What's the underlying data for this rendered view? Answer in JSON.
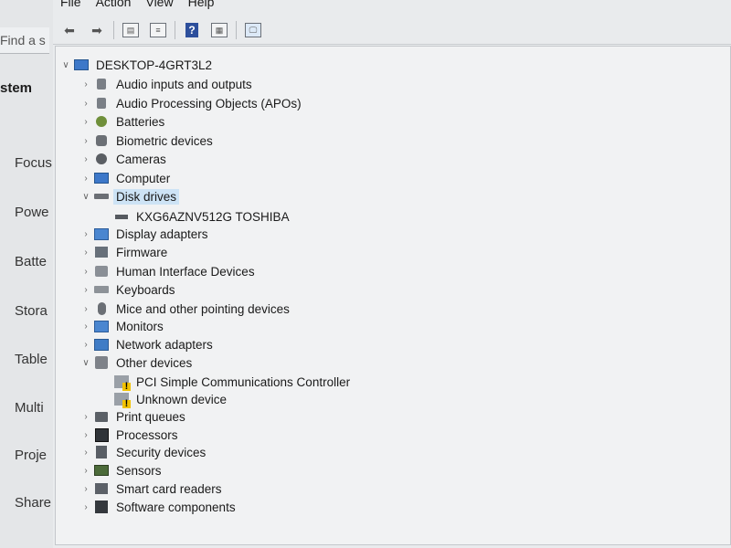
{
  "background": {
    "search_placeholder": "Find a s",
    "section_heading": "stem",
    "items": [
      {
        "label": "Focus",
        "icon": "focus-icon"
      },
      {
        "label": "Powe",
        "icon": "power-icon"
      },
      {
        "label": "Batte",
        "icon": "battery-icon"
      },
      {
        "label": "Stora",
        "icon": "storage-icon"
      },
      {
        "label": "Table",
        "icon": "tablet-icon"
      },
      {
        "label": "Multi",
        "icon": "multitasking-icon"
      },
      {
        "label": "Proje",
        "icon": "projecting-icon"
      },
      {
        "label": "Share",
        "icon": "share-icon"
      }
    ]
  },
  "menubar": {
    "items": [
      "File",
      "Action",
      "View",
      "Help"
    ]
  },
  "toolbar": {
    "buttons": [
      "back-arrow-icon",
      "forward-arrow-icon",
      "show-hide-tree-icon",
      "properties-icon",
      "help-icon",
      "view-options-icon",
      "scan-hardware-icon"
    ]
  },
  "tree": {
    "root": "DESKTOP-4GRT3L2",
    "nodes": [
      {
        "label": "Audio inputs and outputs",
        "icon": "speaker-icon",
        "expanded": false
      },
      {
        "label": "Audio Processing Objects (APOs)",
        "icon": "speaker-icon",
        "expanded": false
      },
      {
        "label": "Batteries",
        "icon": "battery-icon",
        "expanded": false
      },
      {
        "label": "Biometric devices",
        "icon": "biometric-icon",
        "expanded": false
      },
      {
        "label": "Cameras",
        "icon": "camera-icon",
        "expanded": false
      },
      {
        "label": "Computer",
        "icon": "computer-icon",
        "expanded": false
      },
      {
        "label": "Disk drives",
        "icon": "disk-drive-icon",
        "expanded": true,
        "selected": true,
        "children": [
          {
            "label": "KXG6AZNV512G TOSHIBA",
            "icon": "disk-drive-icon"
          }
        ]
      },
      {
        "label": "Display adapters",
        "icon": "monitor-icon",
        "expanded": false
      },
      {
        "label": "Firmware",
        "icon": "chip-icon",
        "expanded": false
      },
      {
        "label": "Human Interface Devices",
        "icon": "hid-icon",
        "expanded": false
      },
      {
        "label": "Keyboards",
        "icon": "keyboard-icon",
        "expanded": false
      },
      {
        "label": "Mice and other pointing devices",
        "icon": "mouse-icon",
        "expanded": false
      },
      {
        "label": "Monitors",
        "icon": "monitor-icon",
        "expanded": false
      },
      {
        "label": "Network adapters",
        "icon": "network-icon",
        "expanded": false
      },
      {
        "label": "Other devices",
        "icon": "other-devices-icon",
        "expanded": true,
        "children": [
          {
            "label": "PCI Simple Communications Controller",
            "icon": "warning-device-icon"
          },
          {
            "label": "Unknown device",
            "icon": "warning-device-icon"
          }
        ]
      },
      {
        "label": "Print queues",
        "icon": "printer-icon",
        "expanded": false
      },
      {
        "label": "Processors",
        "icon": "processor-icon",
        "expanded": false
      },
      {
        "label": "Security devices",
        "icon": "security-icon",
        "expanded": false
      },
      {
        "label": "Sensors",
        "icon": "sensor-icon",
        "expanded": false
      },
      {
        "label": "Smart card readers",
        "icon": "smart-card-icon",
        "expanded": false
      },
      {
        "label": "Software components",
        "icon": "software-icon",
        "expanded": false
      }
    ]
  }
}
